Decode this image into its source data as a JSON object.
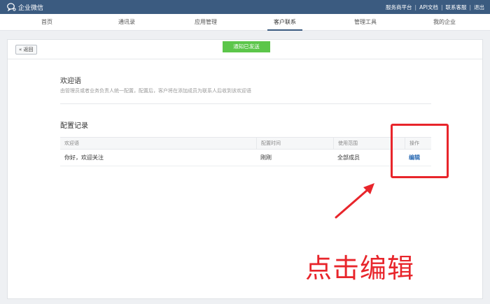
{
  "app": {
    "title": "企业微信"
  },
  "top_links": [
    "服务商平台",
    "API文档",
    "联系客服",
    "退出"
  ],
  "nav": {
    "items": [
      "首页",
      "通讯录",
      "应用管理",
      "客户联系",
      "管理工具",
      "我的企业"
    ],
    "active_index": 3
  },
  "back_button": "« 返回",
  "toast": "通知已发送",
  "welcome": {
    "title": "欢迎语",
    "description": "由管理员或者业务负责人统一配置，配置后，客户将在添加成员为联系人后收到该欢迎语"
  },
  "records": {
    "title": "配置记录",
    "columns": [
      "欢迎语",
      "配置时间",
      "使用范围",
      "操作"
    ],
    "rows": [
      {
        "message": "你好，欢迎关注",
        "time": "刚刚",
        "scope": "全部成员",
        "action": "编辑"
      }
    ]
  },
  "annotation": {
    "text": "点击编辑",
    "color": "#e8252b"
  },
  "colors": {
    "topbar": "#3b5b80",
    "toast": "#5cc64a",
    "link": "#2a6ab3"
  }
}
